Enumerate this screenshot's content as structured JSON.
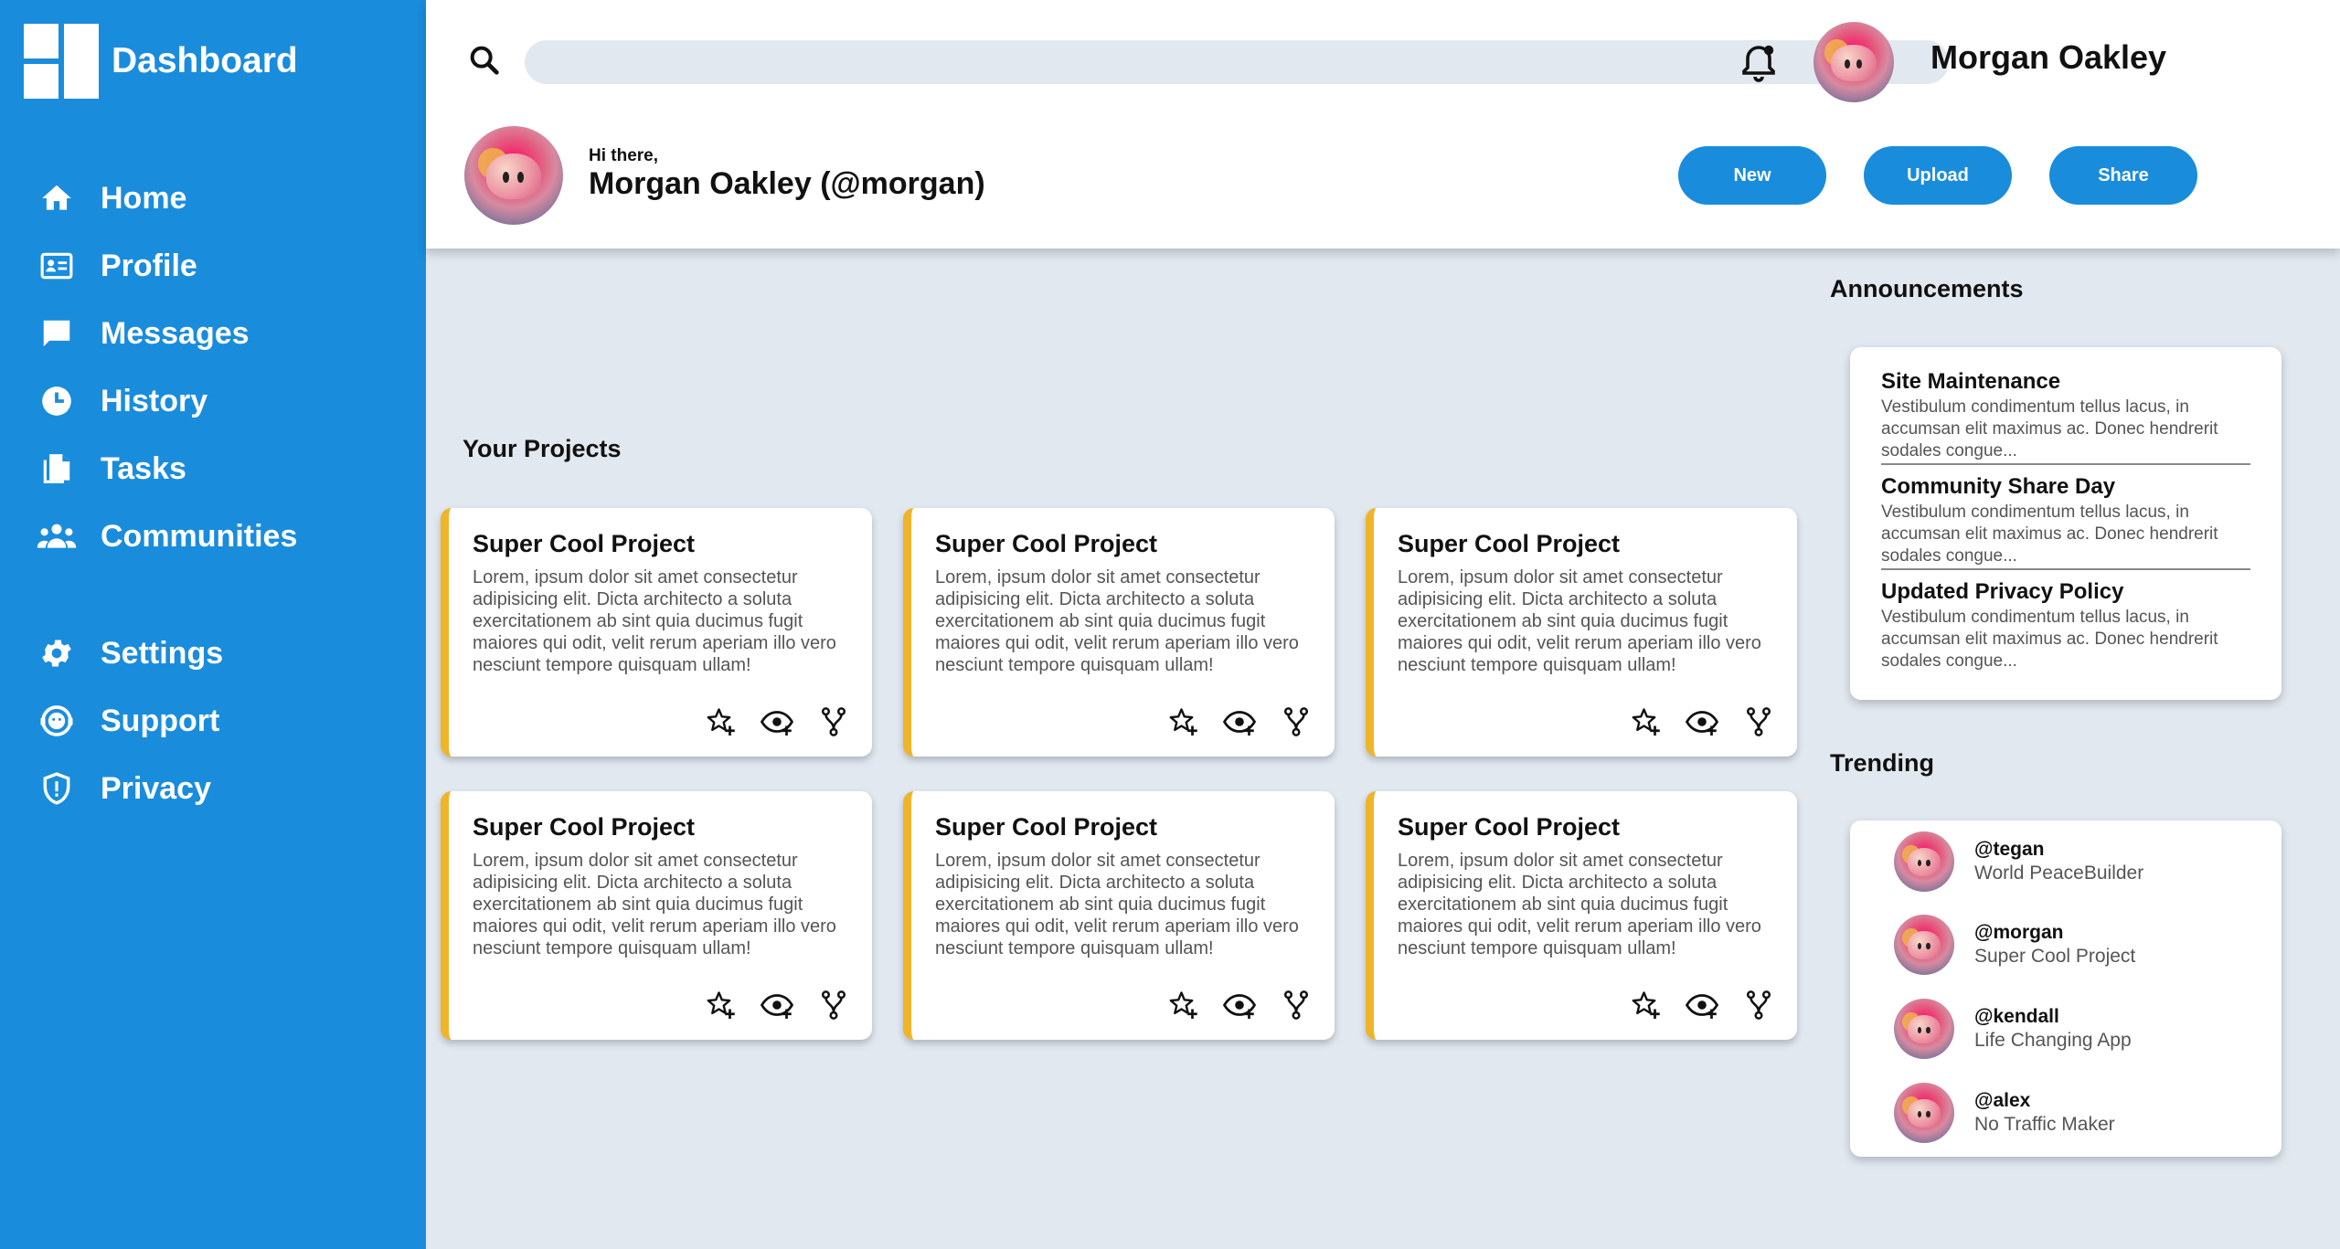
{
  "sidebar": {
    "brand": "Dashboard",
    "items": [
      {
        "label": "Home",
        "icon": "home-icon"
      },
      {
        "label": "Profile",
        "icon": "id-card-icon"
      },
      {
        "label": "Messages",
        "icon": "chat-bubble-icon"
      },
      {
        "label": "History",
        "icon": "clock-icon"
      },
      {
        "label": "Tasks",
        "icon": "documents-icon"
      },
      {
        "label": "Communities",
        "icon": "people-icon"
      },
      {
        "label": "Settings",
        "icon": "gear-icon"
      },
      {
        "label": "Support",
        "icon": "headset-icon"
      },
      {
        "label": "Privacy",
        "icon": "shield-icon"
      }
    ]
  },
  "header": {
    "search_placeholder": "",
    "username": "Morgan Oakley",
    "greeting": "Hi there,",
    "full_name": "Morgan Oakley (@morgan)",
    "buttons": {
      "new": "New",
      "upload": "Upload",
      "share": "Share"
    }
  },
  "projects": {
    "title": "Your Projects",
    "cards": [
      {
        "title": "Super Cool Project",
        "description": "Lorem, ipsum dolor sit amet consectetur adipisicing elit. Dicta architecto a soluta exercitationem ab sint quia ducimus fugit maiores qui odit, velit rerum aperiam illo vero nesciunt tempore quisquam ullam!"
      },
      {
        "title": "Super Cool Project",
        "description": "Lorem, ipsum dolor sit amet consectetur adipisicing elit. Dicta architecto a soluta exercitationem ab sint quia ducimus fugit maiores qui odit, velit rerum aperiam illo vero nesciunt tempore quisquam ullam!"
      },
      {
        "title": "Super Cool Project",
        "description": "Lorem, ipsum dolor sit amet consectetur adipisicing elit. Dicta architecto a soluta exercitationem ab sint quia ducimus fugit maiores qui odit, velit rerum aperiam illo vero nesciunt tempore quisquam ullam!"
      },
      {
        "title": "Super Cool Project",
        "description": "Lorem, ipsum dolor sit amet consectetur adipisicing elit. Dicta architecto a soluta exercitationem ab sint quia ducimus fugit maiores qui odit, velit rerum aperiam illo vero nesciunt tempore quisquam ullam!"
      },
      {
        "title": "Super Cool Project",
        "description": "Lorem, ipsum dolor sit amet consectetur adipisicing elit. Dicta architecto a soluta exercitationem ab sint quia ducimus fugit maiores qui odit, velit rerum aperiam illo vero nesciunt tempore quisquam ullam!"
      },
      {
        "title": "Super Cool Project",
        "description": "Lorem, ipsum dolor sit amet consectetur adipisicing elit. Dicta architecto a soluta exercitationem ab sint quia ducimus fugit maiores qui odit, velit rerum aperiam illo vero nesciunt tempore quisquam ullam!"
      }
    ]
  },
  "announcements": {
    "title": "Announcements",
    "items": [
      {
        "title": "Site Maintenance",
        "body": "Vestibulum condimentum tellus lacus, in accumsan elit maximus ac. Donec hendrerit sodales congue..."
      },
      {
        "title": "Community Share Day",
        "body": "Vestibulum condimentum tellus lacus, in accumsan elit maximus ac. Donec hendrerit sodales congue..."
      },
      {
        "title": "Updated Privacy Policy",
        "body": "Vestibulum condimentum tellus lacus, in accumsan elit maximus ac. Donec hendrerit sodales congue..."
      }
    ]
  },
  "trending": {
    "title": "Trending",
    "items": [
      {
        "handle": "@tegan",
        "project": "World PeaceBuilder"
      },
      {
        "handle": "@morgan",
        "project": "Super Cool Project"
      },
      {
        "handle": "@kendall",
        "project": "Life Changing App"
      },
      {
        "handle": "@alex",
        "project": "No Traffic Maker"
      }
    ]
  },
  "colors": {
    "accent": "#1a8cdc",
    "card_border": "#f0b429",
    "background": "#e2e8f0"
  }
}
